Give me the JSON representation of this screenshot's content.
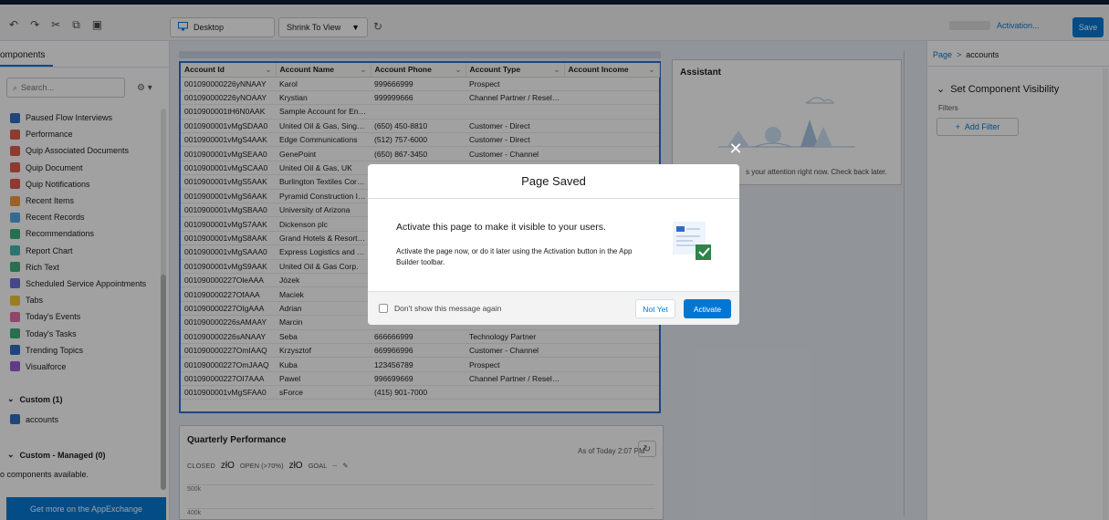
{
  "toolbar": {
    "device_label": "Desktop",
    "shrink_label": "Shrink To View",
    "activation_label": "Activation...",
    "save_label": "Save",
    "icons": [
      "undo-icon",
      "redo-icon",
      "cut-icon",
      "copy-icon",
      "paste-icon"
    ]
  },
  "sidebar": {
    "title": "omponents",
    "search_placeholder": "Search...",
    "items": [
      {
        "label": "Paused Flow Interviews",
        "color": "#2e6bc6"
      },
      {
        "label": "Performance",
        "color": "#e3574b"
      },
      {
        "label": "Quip Associated Documents",
        "color": "#e3574b"
      },
      {
        "label": "Quip Document",
        "color": "#e3574b"
      },
      {
        "label": "Quip Notifications",
        "color": "#e3574b"
      },
      {
        "label": "Recent Items",
        "color": "#f59a3b"
      },
      {
        "label": "Recent Records",
        "color": "#4fa7e6"
      },
      {
        "label": "Recommendations",
        "color": "#3bb07b"
      },
      {
        "label": "Report Chart",
        "color": "#3db9b6"
      },
      {
        "label": "Rich Text",
        "color": "#3bb07b"
      },
      {
        "label": "Scheduled Service Appointments",
        "color": "#6a6ede"
      },
      {
        "label": "Tabs",
        "color": "#f0c43a"
      },
      {
        "label": "Today's Events",
        "color": "#e96aa5"
      },
      {
        "label": "Today's Tasks",
        "color": "#3bb07b"
      },
      {
        "label": "Trending Topics",
        "color": "#2e6bc6"
      },
      {
        "label": "Visualforce",
        "color": "#9b59d8"
      }
    ],
    "custom_section": "Custom (1)",
    "custom_item": "accounts",
    "managed_section": "Custom - Managed (0)",
    "managed_note": "o components available.",
    "appexchange_label": "Get more on the AppExchange"
  },
  "table": {
    "columns": [
      "Account Id",
      "Account Name",
      "Account Phone",
      "Account Type",
      "Account Income"
    ],
    "rows": [
      [
        "001090000226yNNAAY",
        "Karol",
        "999666999",
        "Prospect"
      ],
      [
        "001090000226yNOAAY",
        "Krystian",
        "999999666",
        "Channel Partner / Reseller"
      ],
      [
        "0010900001tH6N0AAK",
        "Sample Account for Entitle...",
        "",
        ""
      ],
      [
        "0010900001vMgSDAA0",
        "United Oil & Gas, Singapore",
        "(650) 450-8810",
        "Customer - Direct"
      ],
      [
        "0010900001vMgS4AAK",
        "Edge Communications",
        "(512) 757-6000",
        "Customer - Direct"
      ],
      [
        "0010900001vMgSEAA0",
        "GenePoint",
        "(650) 867-3450",
        "Customer - Channel"
      ],
      [
        "0010900001vMgSCAA0",
        "United Oil & Gas, UK",
        "",
        ""
      ],
      [
        "0010900001vMgS5AAK",
        "Burlington Textiles Corp of...",
        "",
        ""
      ],
      [
        "0010900001vMgS6AAK",
        "Pyramid Construction Inc.",
        "",
        ""
      ],
      [
        "0010900001vMgSBAA0",
        "University of Arizona",
        "",
        ""
      ],
      [
        "0010900001vMgS7AAK",
        "Dickenson plc",
        "",
        ""
      ],
      [
        "0010900001vMgS8AAK",
        "Grand Hotels & Resorts Ltd",
        "",
        ""
      ],
      [
        "0010900001vMgSAAA0",
        "Express Logistics and Trans...",
        "",
        ""
      ],
      [
        "0010900001vMgS9AAK",
        "United Oil & Gas Corp.",
        "",
        ""
      ],
      [
        "001090000227OleAAA",
        "Józek",
        "",
        ""
      ],
      [
        "001090000227OfAAA",
        "Maciek",
        "",
        ""
      ],
      [
        "001090000227OIgAAA",
        "Adrian",
        "",
        ""
      ],
      [
        "001090000226sAMAAY",
        "Marcin",
        "666999666",
        "Customer - Direct"
      ],
      [
        "001090000226sANAAY",
        "Seba",
        "666666999",
        "Technology Partner"
      ],
      [
        "001090000227OmIAAQ",
        "Krzysztof",
        "669966996",
        "Customer - Channel"
      ],
      [
        "001090000227OmJAAQ",
        "Kuba",
        "123456789",
        "Prospect"
      ],
      [
        "001090000227OI7AAA",
        "Pawel",
        "996699669",
        "Channel Partner / Reseller"
      ],
      [
        "0010900001vMgSFAA0",
        "sForce",
        "(415) 901-7000",
        ""
      ]
    ]
  },
  "assistant": {
    "title": "Assistant",
    "message": "s your attention right now. Check back later."
  },
  "quarterly": {
    "title": "Quarterly Performance",
    "as_of": "As of Today 2:07 PM",
    "closed_label": "CLOSED",
    "closed_value": "złO",
    "open_label": "OPEN (>70%)",
    "open_value": "złO",
    "goal_label": "GOAL",
    "goal_value": "--",
    "y_tick_1": "500k",
    "y_tick_2": "400k"
  },
  "props": {
    "breadcrumb_root": "Page",
    "breadcrumb_current": "accounts",
    "section_title": "Set Component Visibility",
    "filters_label": "Filters",
    "add_filter_label": "Add Filter"
  },
  "modal": {
    "title": "Page Saved",
    "heading": "Activate this page to make it visible to your users.",
    "text": "Activate the page now, or do it later using the Activation button in the App Builder toolbar.",
    "checkbox_label": "Don't show this message again",
    "not_yet_label": "Not Yet",
    "activate_label": "Activate",
    "accent_color": "#0176d3",
    "success_color": "#2e844a"
  }
}
